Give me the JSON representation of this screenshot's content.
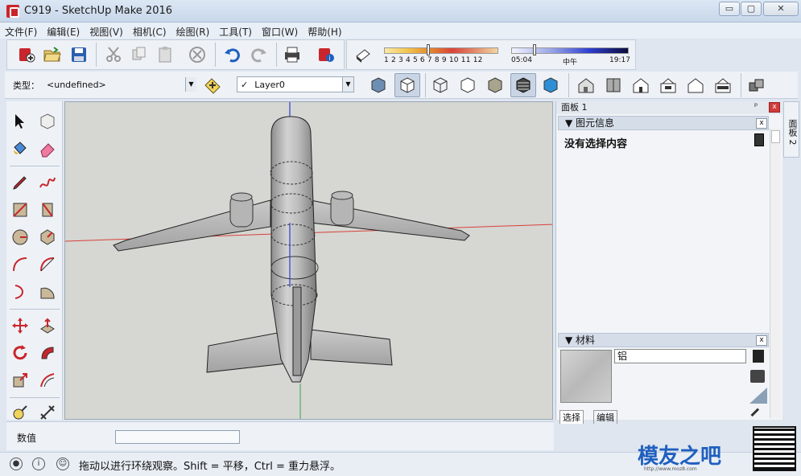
{
  "window": {
    "title": "C919 - SketchUp Make 2016",
    "minimize_label": "▭",
    "maximize_label": "▢",
    "close_label": "✕"
  },
  "menu": [
    "文件(F)",
    "编辑(E)",
    "视图(V)",
    "相机(C)",
    "绘图(R)",
    "工具(T)",
    "窗口(W)",
    "帮助(H)"
  ],
  "shadow_toolbar": {
    "months": "1 2 3 4 5 6 7 8 9 10 11 12",
    "time_start": "05:04",
    "time_mid": "中午",
    "time_end": "19:17"
  },
  "entity_toolbar": {
    "type_label": "类型：",
    "type_value": "<undefined>",
    "layer_check": "✓",
    "layer_value": "Layer0"
  },
  "tray": {
    "title": "面板 1",
    "pin_label": "ᵖ",
    "close_label": "x",
    "entity_info": {
      "header": "图元信息",
      "message": "没有选择内容"
    },
    "materials": {
      "header": "材料",
      "name": "铝",
      "tabs": [
        "选择",
        "编辑"
      ]
    }
  },
  "side_tab": "面板 2",
  "value_label": "数值",
  "status_text": "拖动以进行环绕观察。Shift = 平移，Ctrl = 重力悬浮。",
  "watermark": {
    "brand": "模友之吧",
    "url": "http://www.moz8.com"
  },
  "colors": {
    "viewport_bg": "#d6d6d2",
    "axis_red": "#d9403a",
    "axis_green": "#3aa54a",
    "axis_blue": "#2f3fd0",
    "brand_red": "#c8262c"
  }
}
